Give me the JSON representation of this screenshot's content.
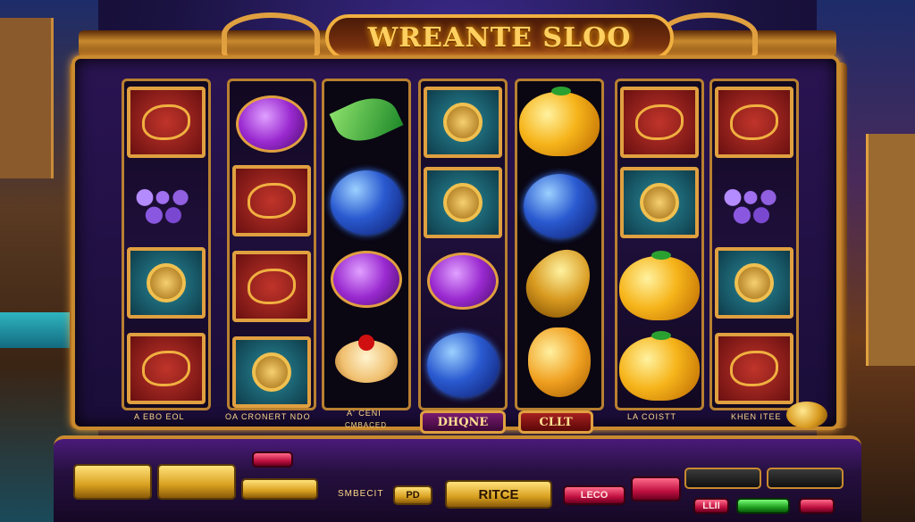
{
  "game": {
    "title": "WREANTE SLOO"
  },
  "reel_strip": {
    "top_left": "",
    "top_center": "",
    "top_right": ""
  },
  "bottom_strip": {
    "left": "A EBO EOL",
    "center_left": "OA CRONERT NDO",
    "center": "A' CENI",
    "center_sub": "CMBACED",
    "center_right": "LA COISTT",
    "right": "KHEN ITEE"
  },
  "plaques": {
    "left": "DHQNE",
    "right": "CLLT"
  },
  "console": {
    "spin_label": "RITCE",
    "bet_label": "SMBECIT",
    "small_label": "PD",
    "right_red_label": "LECO",
    "small_red_label": "",
    "side_panel_1": "",
    "side_panel_2": "",
    "bottom_1": "LLII",
    "bottom_2": "",
    "bottom_3": ""
  },
  "reels": [
    [
      "red-ornate-tile",
      "grapes",
      "teal-medallion-tile",
      "red-ornate-tile"
    ],
    [
      "purple-berry",
      "red-emblem-tile",
      "red-emblem-tile",
      "gold-frame-tile"
    ],
    [
      "green-leaf",
      "blue-plum",
      "purple-berry",
      "cherry-cake"
    ],
    [
      "gold-medallion-tile",
      "gold-medallion-tile",
      "purple-berry",
      "blue-plum-slice"
    ],
    [
      "orange",
      "blue-plum",
      "gold-lemon",
      "gold-pear"
    ],
    [
      "red-emblem-tile",
      "gold-emblem-tile",
      "orange",
      "orange"
    ],
    [
      "red-ornate-tile",
      "grapes",
      "teal-medallion-tile",
      "red-ornate-tile"
    ]
  ]
}
